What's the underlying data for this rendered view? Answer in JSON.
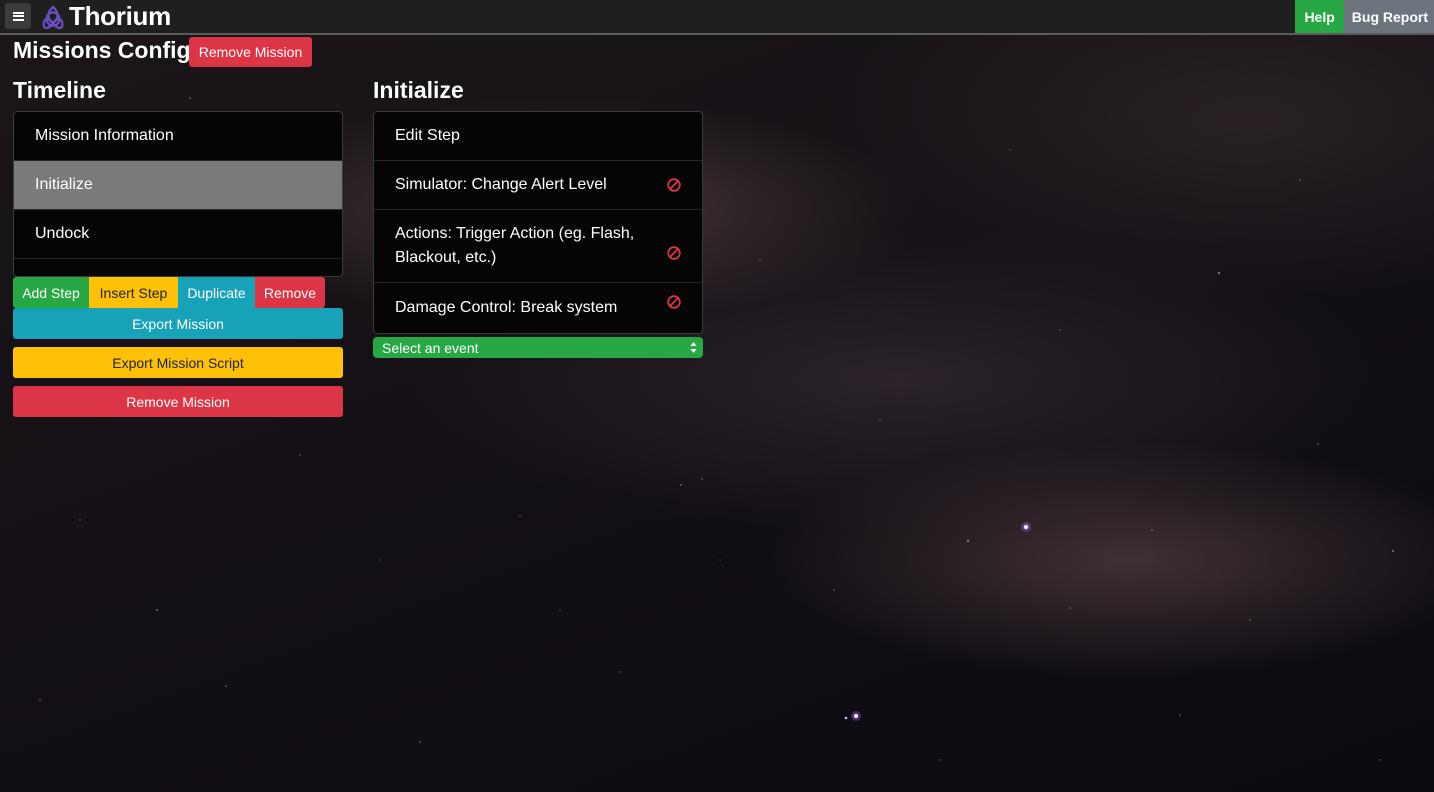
{
  "navbar": {
    "menu_icon": "hamburger-menu-icon",
    "logo_icon": "thorium-triquetra-logo",
    "brand": "Thorium",
    "help_label": "Help",
    "bug_report_label": "Bug Report"
  },
  "header": {
    "title": "Missions Config",
    "remove_mission_label": "Remove Mission"
  },
  "timeline": {
    "title": "Timeline",
    "items": [
      {
        "label": "Mission Information",
        "active": false
      },
      {
        "label": "Initialize",
        "active": true
      },
      {
        "label": "Undock",
        "active": false
      }
    ],
    "buttons": {
      "add_step": "Add Step",
      "insert_step": "Insert Step",
      "duplicate": "Duplicate",
      "remove": "Remove"
    },
    "export_mission": "Export Mission",
    "export_mission_script": "Export Mission Script",
    "remove_mission": "Remove Mission"
  },
  "initialize": {
    "title": "Initialize",
    "edit_step_label": "Edit Step",
    "events": [
      {
        "label": "Simulator: Change Alert Level",
        "icon": "remove-circle-icon"
      },
      {
        "label": "Actions: Trigger Action (eg. Flash, Blackout, etc.)",
        "icon": "remove-circle-icon"
      },
      {
        "label": "Damage Control: Break system",
        "icon": "remove-circle-icon"
      }
    ],
    "select_event": {
      "selected": "Select an event"
    }
  },
  "colors": {
    "success": "#28a745",
    "warning": "#ffc107",
    "info": "#17a2b8",
    "danger": "#dc3545",
    "secondary": "#6c757d",
    "brand_purple": "#6a4fc4"
  }
}
